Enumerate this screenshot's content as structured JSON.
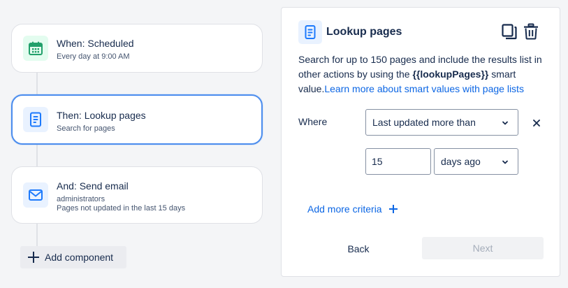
{
  "flow": {
    "items": [
      {
        "title": "When: Scheduled",
        "subtitle": "Every day at 9:00 AM",
        "icon": "calendar-icon"
      },
      {
        "title": "Then: Lookup pages",
        "subtitle": "Search for pages",
        "icon": "page-icon"
      },
      {
        "title": "And: Send email",
        "subtitle_lines": [
          "administrators",
          "Pages not updated in the last 15 days"
        ],
        "icon": "mail-icon"
      }
    ],
    "add_component_label": "Add component"
  },
  "panel": {
    "title": "Lookup pages",
    "description_prefix": "Search for up to 150 pages and include the results list in other actions by using the ",
    "smart_value": "{{lookupPages}}",
    "description_suffix": " smart value.",
    "learn_more_link": "Learn more about smart values with page lists",
    "where_label": "Where",
    "condition_select": "Last updated more than",
    "amount_value": "15",
    "unit_select": "days ago",
    "add_criteria_label": "Add more criteria",
    "back_label": "Back",
    "next_label": "Next"
  },
  "colors": {
    "accent": "#0c66e4",
    "active_border": "#4c8dee",
    "schedule_icon": "#22a06b",
    "page_icon": "#1d7afc"
  }
}
